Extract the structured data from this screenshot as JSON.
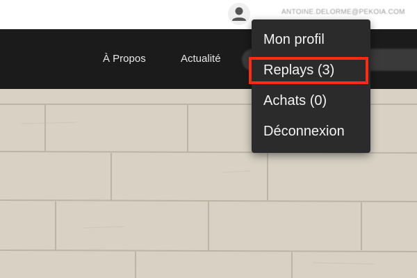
{
  "header": {
    "user_icon": "user-avatar-icon",
    "user_email": "ANTOINE.DELORME@PEKOIA.COM"
  },
  "nav": {
    "items": [
      {
        "label": "À Propos"
      },
      {
        "label": "Actualité"
      }
    ]
  },
  "user_menu": {
    "items": [
      {
        "label": "Mon profil"
      },
      {
        "label": "Replays (3)"
      },
      {
        "label": "Achats (0)"
      },
      {
        "label": "Déconnexion"
      }
    ],
    "highlighted_item": "Replays (3)",
    "highlight_color": "#ff2a14",
    "background_color": "#2b2b2b"
  },
  "colors": {
    "navbar": "#1b1b1b",
    "wall": "#d8d1c4"
  }
}
